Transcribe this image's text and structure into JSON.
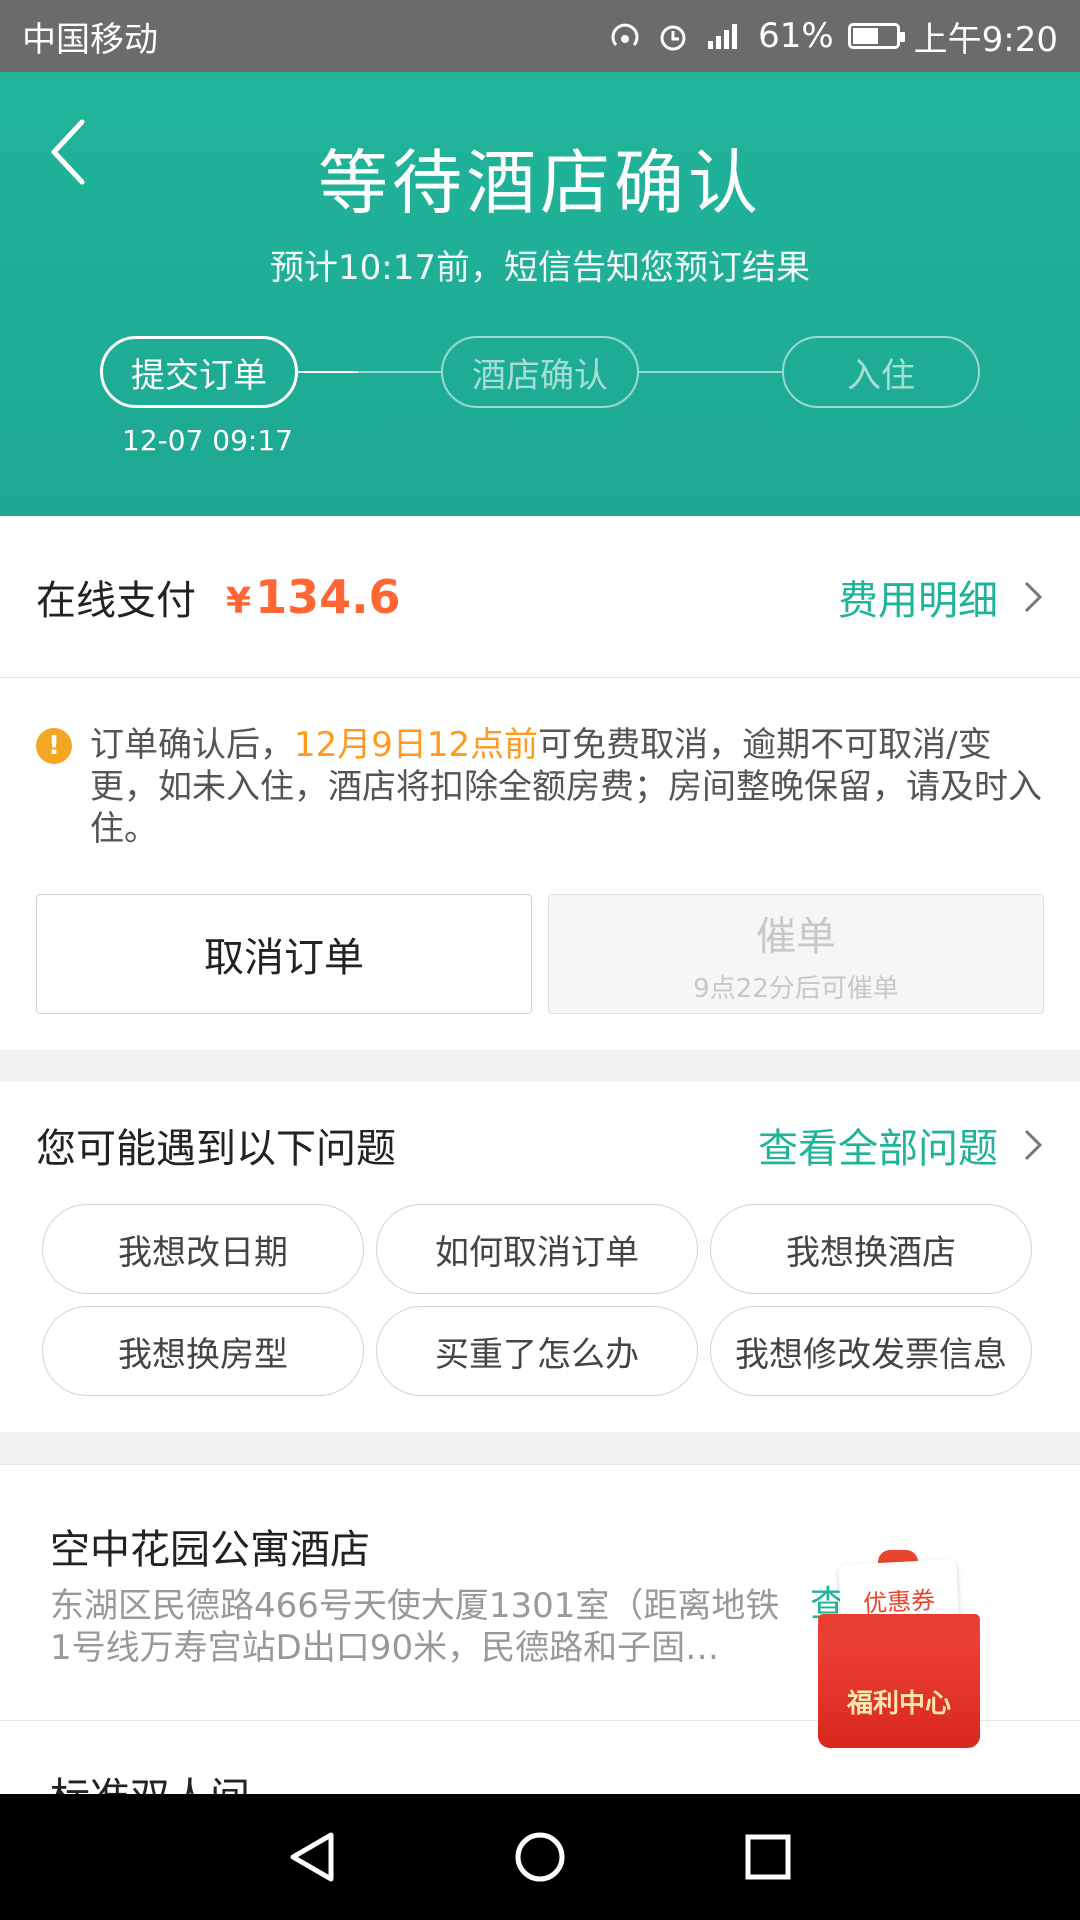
{
  "status_bar": {
    "carrier": "中国移动",
    "battery": "61%",
    "battery_level": 0.61,
    "time": "上午9:20"
  },
  "header": {
    "title": "等待酒店确认",
    "subtitle": "预计10:17前，短信告知您预订结果",
    "steps": [
      {
        "label": "提交订单",
        "time": "12-07 09:17",
        "active": true
      },
      {
        "label": "酒店确认",
        "active": false
      },
      {
        "label": "入住",
        "active": false
      }
    ],
    "accent_color": "#20b59b"
  },
  "payment": {
    "label": "在线支付",
    "currency": "¥",
    "amount": "134.6",
    "detail_link": "费用明细"
  },
  "notice": {
    "before": "订单确认后，",
    "highlight": "12月9日12点前",
    "after": "可免费取消，逾期不可取消/变更，如未入住，酒店将扣除全额房费；房间整晚保留，请及时入住。"
  },
  "actions": {
    "cancel_label": "取消订单",
    "urge_label": "催单",
    "urge_sub": "9点22分后可催单"
  },
  "faq": {
    "title": "您可能遇到以下问题",
    "view_all": "查看全部问题",
    "chips": [
      "我想改日期",
      "如何取消订单",
      "我想换酒店",
      "我想换房型",
      "买重了怎么办",
      "我想修改发票信息"
    ]
  },
  "hotel": {
    "name": "空中花园公寓酒店",
    "address": "东湖区民德路466号天使大厦1301室（距离地铁1号线万寿宫站D出口90米，民德路和子固…",
    "link": "查"
  },
  "room": {
    "name": "标准双人间"
  },
  "coupon": {
    "paper_label": "优惠券",
    "envelope_label": "福利中心"
  }
}
